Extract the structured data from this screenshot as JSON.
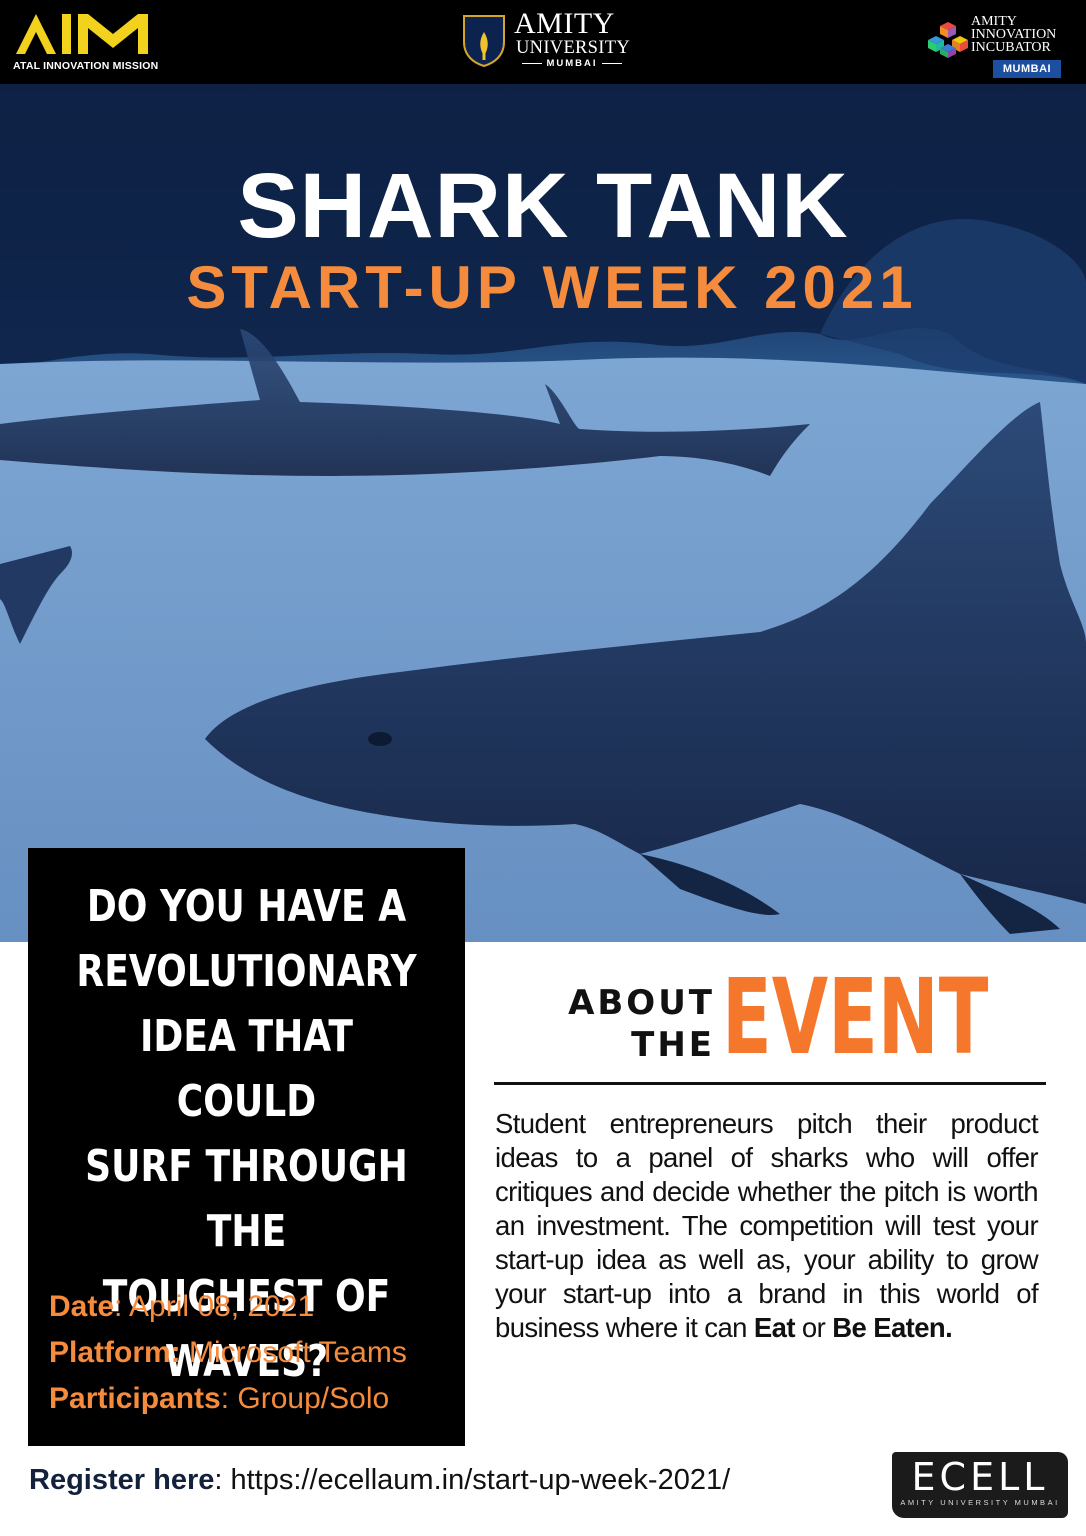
{
  "header": {
    "aim_logo": {
      "mark_text": "AIM",
      "subtitle": "ATAL INNOVATION MISSION"
    },
    "amity_logo": {
      "crest_text": "AMITY",
      "name": "AMITY",
      "line2": "UNIVERSITY",
      "city": "MUMBAI"
    },
    "incubator_logo": {
      "line1": "AMITY",
      "line2": "INNOVATION",
      "line3": "INCUBATOR",
      "badge": "MUMBAI"
    }
  },
  "hero": {
    "title": "SHARK TANK",
    "subtitle": "START-UP WEEK 2021"
  },
  "question_box": {
    "question_lines": [
      "DO YOU HAVE A",
      "REVOLUTIONARY",
      "IDEA THAT COULD",
      "SURF THROUGH THE",
      "TOUGHEST OF",
      "WAVES?"
    ],
    "details": [
      {
        "label": "Date",
        "value": ": April 08, 2021"
      },
      {
        "label": "Platform:",
        "value": " Microsoft Teams"
      },
      {
        "label": "Participants",
        "value": ": Group/Solo"
      }
    ]
  },
  "about": {
    "heading_small_1": "ABOUT",
    "heading_small_2": "THE",
    "heading_big": "EVENT",
    "body_part1": "Student entrepreneurs pitch their product ideas to a panel of sharks who will offer critiques and decide whether the pitch is worth an investment. The competition will test your start-up idea as well as, your ability to grow your start-up into a brand in this world of business where it can ",
    "body_bold1": "Eat",
    "body_part2": " or ",
    "body_bold2": "Be Eaten."
  },
  "footer": {
    "register_label": "Register here",
    "register_url": ": https://ecellaum.in/start-up-week-2021/",
    "ecell_logo": {
      "word": "ECELL",
      "subtitle": "AMITY UNIVERSITY MUMBAI"
    }
  },
  "colors": {
    "accent_orange": "#f58b3c",
    "about_orange": "#f5772c",
    "black": "#000000",
    "incubator_blue": "#1d4fa0"
  }
}
